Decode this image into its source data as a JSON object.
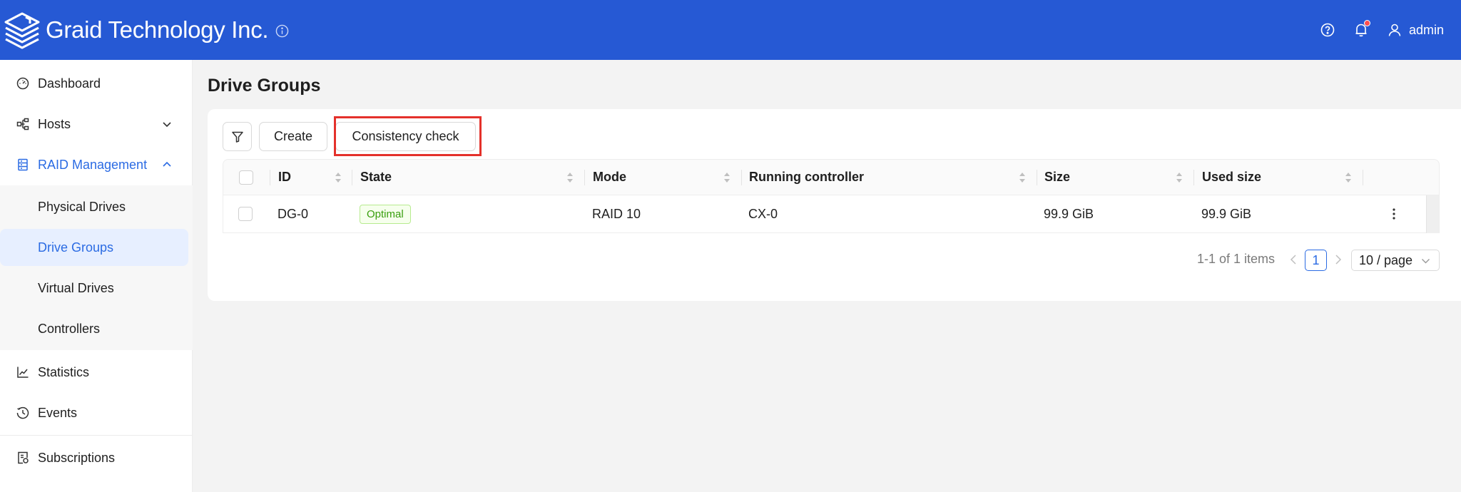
{
  "header": {
    "brand": "Graid Technology Inc.",
    "user": "admin",
    "colors": {
      "bar": "#2659d4",
      "notification_dot": "#ff4d4f"
    },
    "icons": [
      "graid-logo-icon",
      "info-icon",
      "help-icon",
      "bell-icon",
      "user-icon"
    ]
  },
  "sidebar": {
    "items": [
      {
        "label": "Dashboard",
        "icon": "dashboard-icon"
      },
      {
        "label": "Hosts",
        "icon": "hosts-icon"
      },
      {
        "label": "RAID Management",
        "icon": "raid-icon"
      },
      {
        "label": "Statistics",
        "icon": "statistics-icon"
      },
      {
        "label": "Events",
        "icon": "events-icon"
      },
      {
        "label": "Subscriptions",
        "icon": "subscriptions-icon"
      }
    ],
    "raid_sub": [
      {
        "label": "Physical Drives"
      },
      {
        "label": "Drive Groups"
      },
      {
        "label": "Virtual Drives"
      },
      {
        "label": "Controllers"
      }
    ],
    "active_color": "#2b6be3"
  },
  "main": {
    "title": "Drive Groups",
    "toolbar": {
      "create_label": "Create",
      "consistency_label": "Consistency check",
      "highlight_color": "#e4312b"
    },
    "table": {
      "columns": [
        "ID",
        "State",
        "Mode",
        "Running controller",
        "Size",
        "Used size"
      ],
      "rows": [
        {
          "id": "DG-0",
          "state": "Optimal",
          "mode": "RAID 10",
          "controller": "CX-0",
          "size": "99.9 GiB",
          "used": "99.9 GiB"
        }
      ]
    },
    "pagination": {
      "total": "1-1 of 1 items",
      "current": "1",
      "page_size": "10 / page"
    }
  }
}
